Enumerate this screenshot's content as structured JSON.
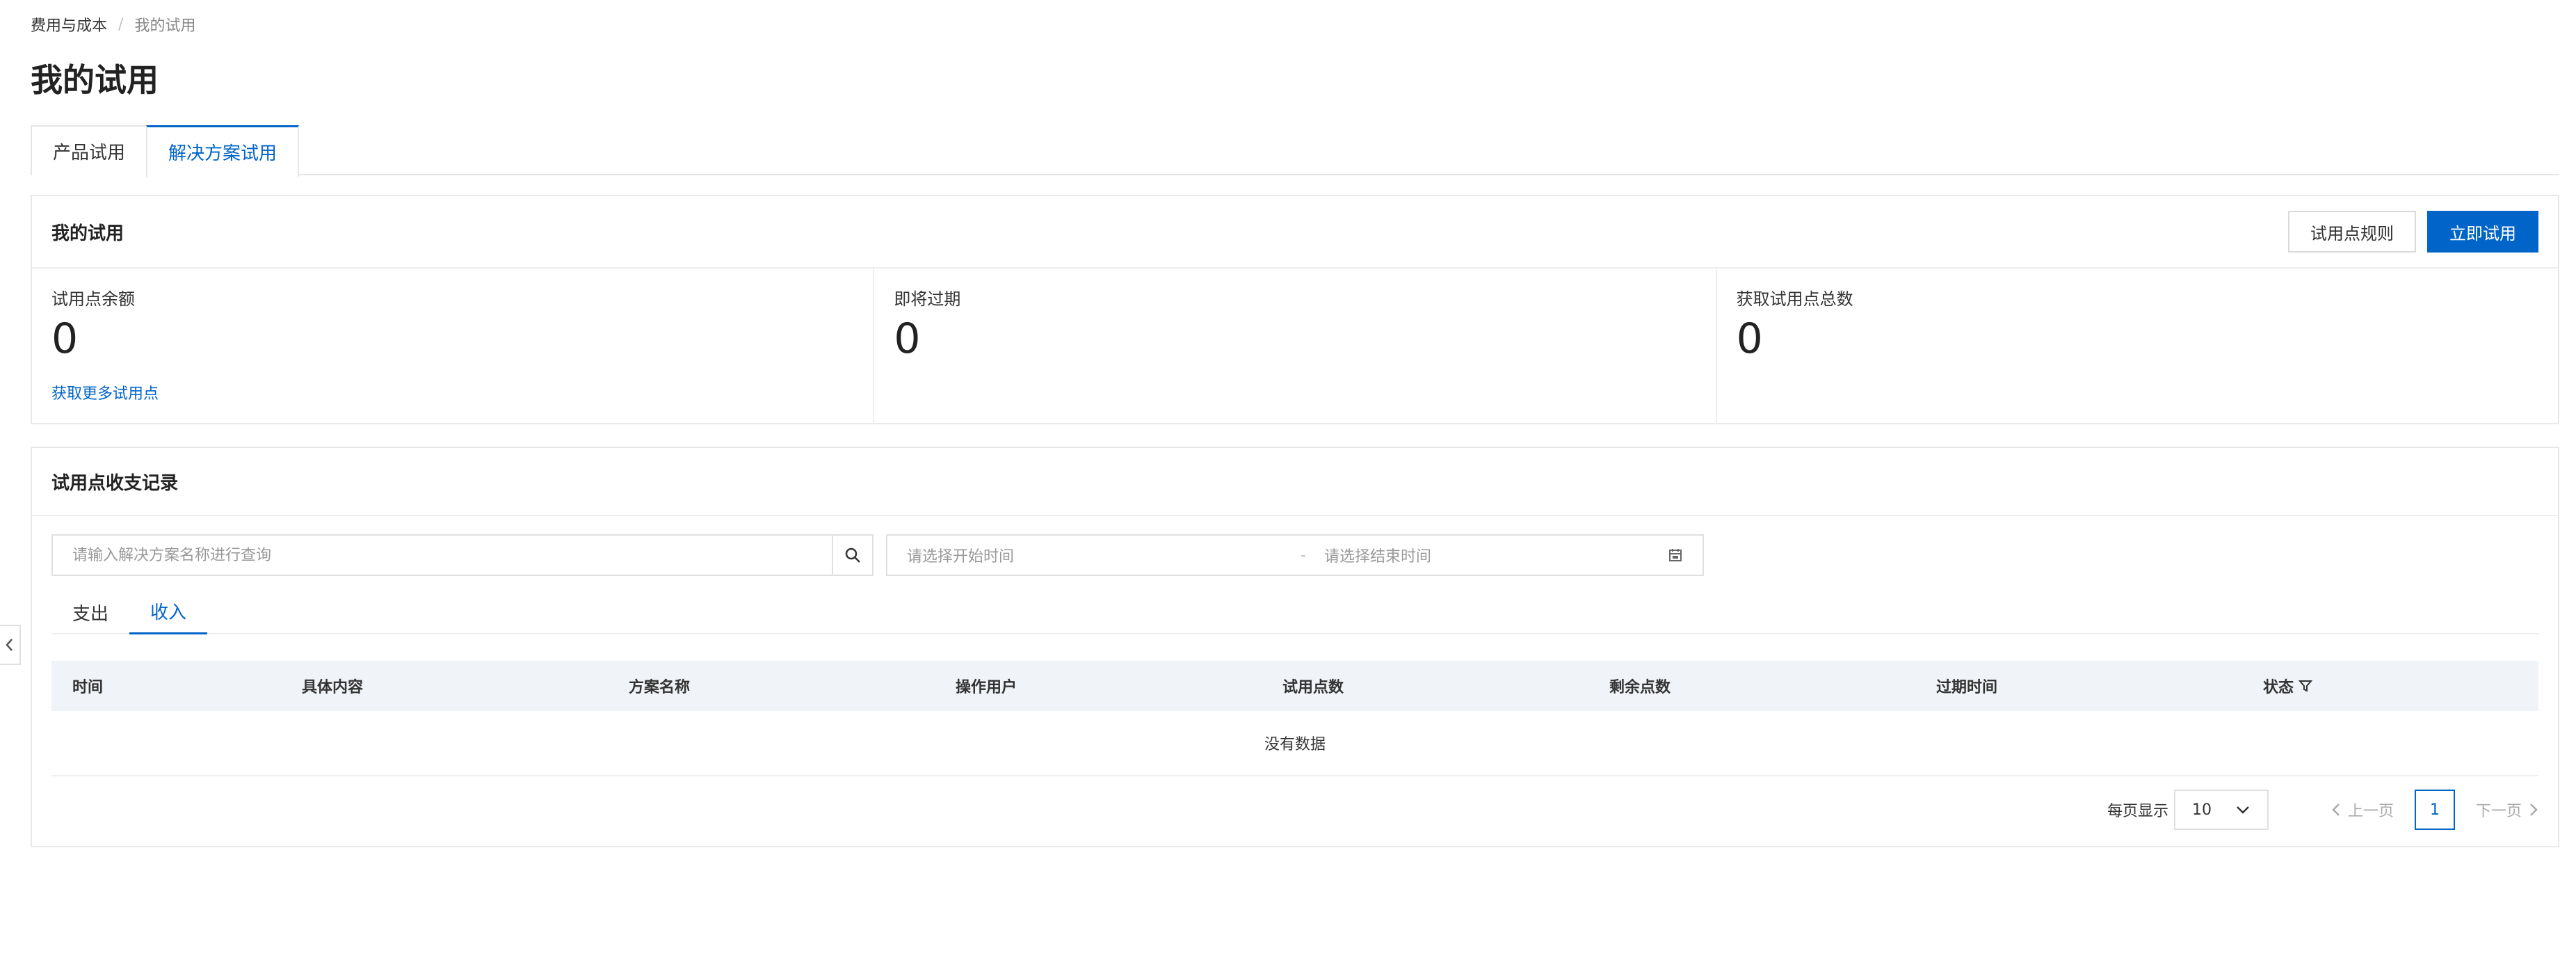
{
  "breadcrumb": {
    "parent": "费用与成本",
    "separator": "/",
    "current": "我的试用"
  },
  "page_title": "我的试用",
  "tabs": [
    {
      "label": "产品试用",
      "active": false
    },
    {
      "label": "解决方案试用",
      "active": true
    }
  ],
  "summary": {
    "title": "我的试用",
    "rules_button": "试用点规则",
    "try_button": "立即试用",
    "stats": [
      {
        "label": "试用点余额",
        "value": "0"
      },
      {
        "label": "即将过期",
        "value": "0"
      },
      {
        "label": "获取试用点总数",
        "value": "0"
      }
    ],
    "more_link": "获取更多试用点"
  },
  "records": {
    "title": "试用点收支记录",
    "search_placeholder": "请输入解决方案名称进行查询",
    "start_placeholder": "请选择开始时间",
    "range_separator": "-",
    "end_placeholder": "请选择结束时间",
    "subtabs": [
      {
        "label": "支出",
        "active": false
      },
      {
        "label": "收入",
        "active": true
      }
    ],
    "columns": [
      "时间",
      "具体内容",
      "方案名称",
      "操作用户",
      "试用点数",
      "剩余点数",
      "过期时间",
      "状态"
    ],
    "empty_text": "没有数据",
    "pagination": {
      "page_size_label": "每页显示",
      "page_size": "10",
      "prev": "上一页",
      "current_page": "1",
      "next": "下一页"
    }
  },
  "colors": {
    "accent": "#0064c8",
    "header_bg": "#f0f3f7",
    "border": "#e8e8e8"
  }
}
